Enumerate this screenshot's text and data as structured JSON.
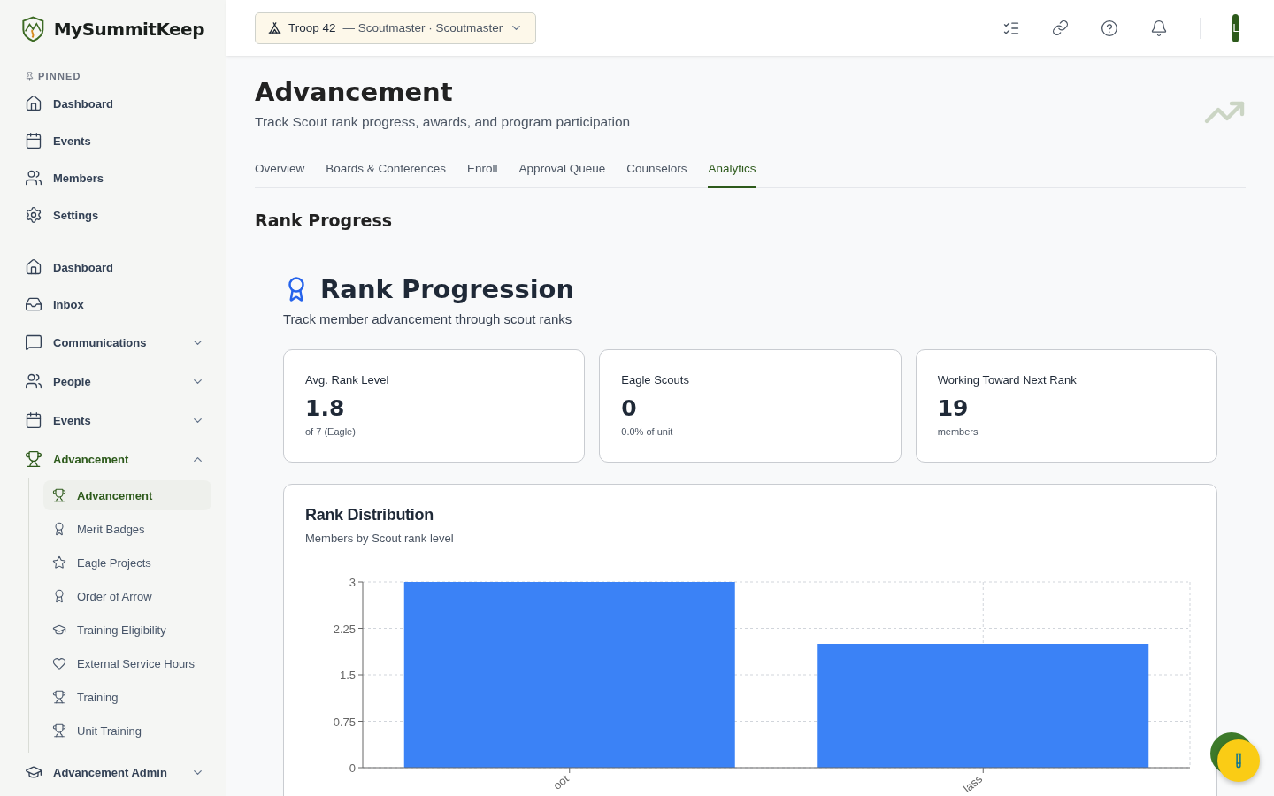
{
  "brand": {
    "name": "MySummitKeep"
  },
  "sidebar": {
    "pinned_label": "PINNED",
    "pinned": [
      {
        "label": "Dashboard"
      },
      {
        "label": "Events"
      },
      {
        "label": "Members"
      },
      {
        "label": "Settings"
      }
    ],
    "items": [
      {
        "label": "Dashboard",
        "kind": "link"
      },
      {
        "label": "Inbox",
        "kind": "link"
      },
      {
        "label": "Communications",
        "kind": "group",
        "expanded": false,
        "active": false
      },
      {
        "label": "People",
        "kind": "group",
        "expanded": false,
        "active": false
      },
      {
        "label": "Events",
        "kind": "group",
        "expanded": false,
        "active": false
      },
      {
        "label": "Advancement",
        "kind": "group",
        "expanded": true,
        "active": true,
        "children": [
          {
            "label": "Advancement",
            "selected": true
          },
          {
            "label": "Merit Badges",
            "selected": false
          },
          {
            "label": "Eagle Projects",
            "selected": false
          },
          {
            "label": "Order of Arrow",
            "selected": false
          },
          {
            "label": "Training Eligibility",
            "selected": false
          },
          {
            "label": "External Service Hours",
            "selected": false
          },
          {
            "label": "Training",
            "selected": false
          },
          {
            "label": "Unit Training",
            "selected": false
          }
        ]
      },
      {
        "label": "Advancement Admin",
        "kind": "group",
        "expanded": false,
        "active": false
      }
    ]
  },
  "header": {
    "unit": "Troop 42",
    "role": "— Scoutmaster · Scoutmaster",
    "avatar": "L"
  },
  "page": {
    "title": "Advancement",
    "subtitle": "Track Scout rank progress, awards, and program participation",
    "tabs": [
      {
        "label": "Overview",
        "selected": false
      },
      {
        "label": "Boards & Conferences",
        "selected": false
      },
      {
        "label": "Enroll",
        "selected": false
      },
      {
        "label": "Approval Queue",
        "selected": false
      },
      {
        "label": "Counselors",
        "selected": false
      },
      {
        "label": "Analytics",
        "selected": true
      }
    ],
    "section_title": "Rank Progress",
    "panel": {
      "title": "Rank Progression",
      "subtitle": "Track member advancement through scout ranks",
      "stats": [
        {
          "label": "Avg. Rank Level",
          "value": "1.8",
          "note": "of 7 (Eagle)"
        },
        {
          "label": "Eagle Scouts",
          "value": "0",
          "note": "0.0% of unit"
        },
        {
          "label": "Working Toward Next Rank",
          "value": "19",
          "note": "members"
        }
      ],
      "distribution": {
        "title": "Rank Distribution",
        "subtitle": "Members by Scout rank level",
        "chart_data": {
          "type": "bar",
          "grid": true,
          "categories": [
            "oot",
            "lass"
          ],
          "series": [
            {
              "color": "#3b82f6",
              "values": [
                3,
                2
              ]
            }
          ],
          "ylim": [
            0,
            3
          ],
          "yticks": [
            0,
            {
              "value": 0.75,
              "label": "0.75"
            },
            {
              "value": 1.5,
              "label": "1.5"
            },
            {
              "value": 2.25,
              "label": "2.25"
            },
            3
          ]
        }
      }
    }
  }
}
